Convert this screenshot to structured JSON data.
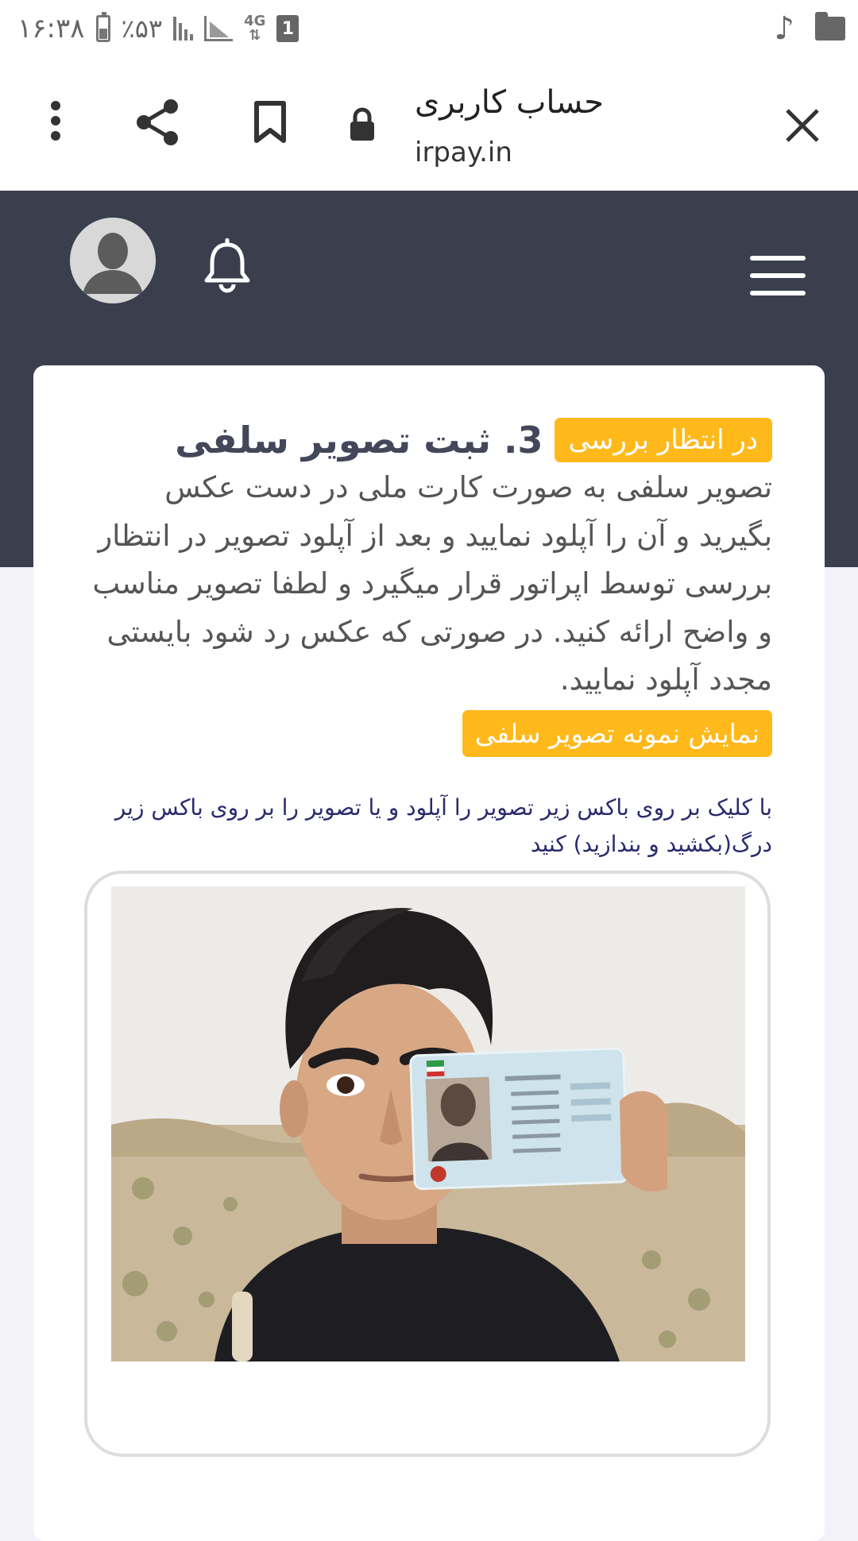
{
  "status_bar": {
    "time": "۱۶:۳۸",
    "battery": "٪۵۳",
    "network": "4G",
    "sim_slot": "1"
  },
  "browser": {
    "page_title": "حساب کاربری",
    "url": "irpay.in"
  },
  "step": {
    "title": "3. ثبت تصویر سلفی",
    "status_badge": "در انتظار بررسی",
    "description": "تصویر سلفی به صورت کارت ملی در دست عکس بگیرید و آن را آپلود نمایید و بعد از آپلود تصویر در انتظار بررسی توسط اپراتور قرار میگیرد و لطفا تصویر مناسب و واضح ارائه کنید. در صورتی که عکس رد شود بایستی مجدد آپلود نمایید.",
    "sample_button": "نمایش نمونه تصویر سلفی",
    "upload_hint": "با کلیک بر روی باکس زیر تصویر را آپلود و یا تصویر را بر روی باکس زیر درگ(بکشید و بندازید) کنید"
  },
  "colors": {
    "header_bg": "#3b3e4d",
    "accent": "#ffb91b",
    "page_bg": "#f2f2f8"
  }
}
